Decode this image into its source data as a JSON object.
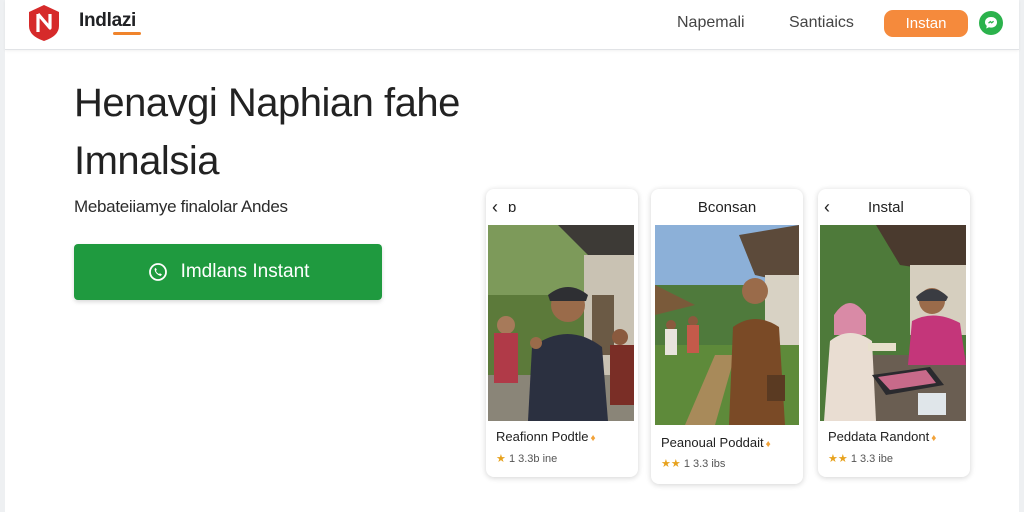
{
  "header": {
    "brand": "Indlazi",
    "nav": [
      "Napemali",
      "Santiaics"
    ],
    "cta_label": "Instan"
  },
  "hero": {
    "title_line1": "Henavgi Naphian fahe",
    "title_line2": "Imnalsia",
    "subtitle": "Mebateiiamye finalolar Andes",
    "cta_label": "Imdlans Instant"
  },
  "cards": [
    {
      "header_label": "ɒ",
      "title": "Reafionn Podtle",
      "stars": 1,
      "rating_text": "1  3.3b ine"
    },
    {
      "header_label": "Bconsan",
      "title": "Peanoual Poddait",
      "stars": 2,
      "rating_text": "1 3.3 ibs"
    },
    {
      "header_label": "Instal",
      "title": "Peddata Randont",
      "stars": 2,
      "rating_text": "1 3.3 ibe"
    }
  ],
  "colors": {
    "accent_orange": "#f58a3c",
    "primary_green": "#1f9a3f",
    "status_green": "#2bb24c",
    "logo_red": "#d62a2a",
    "star_gold": "#e7a21e"
  },
  "icons": {
    "logo": "shield-logo-icon",
    "status": "chat-bubble-icon",
    "cta": "phone-icon",
    "back": "chevron-left-icon",
    "star": "star-icon"
  }
}
